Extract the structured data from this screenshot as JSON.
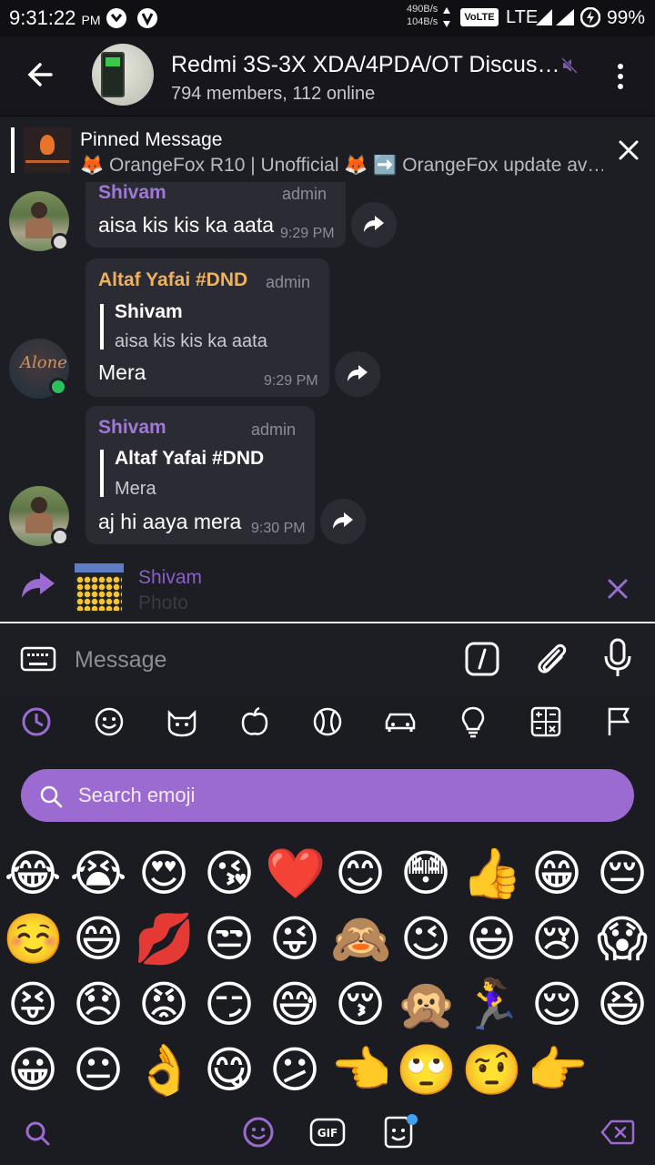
{
  "status_bar": {
    "time": "9:31:22",
    "ampm": "PM",
    "net_up": "490B/s",
    "net_down": "104B/s",
    "volte": "VoLTE",
    "lte": "LTE",
    "battery": "99%"
  },
  "header": {
    "title": "Redmi 3S-3X XDA/4PDA/OT Discus…",
    "subtitle": "794 members, 112 online"
  },
  "pinned": {
    "label": "Pinned Message",
    "text": "🦊 OrangeFox R10 | Unofficial 🦊 ➡️ OrangeFox update av…"
  },
  "messages": [
    {
      "sender": "Shivam",
      "tag": "admin",
      "text": "aisa kis kis ka aata",
      "time": "9:29 PM"
    },
    {
      "sender": "Altaf Yafai #DND",
      "tag": "admin",
      "reply_name": "Shivam",
      "reply_text": "aisa kis kis ka aata",
      "text": "Mera",
      "time": "9:29 PM",
      "avatar_text": "Alone"
    },
    {
      "sender": "Shivam",
      "tag": "admin",
      "reply_name": "Altaf Yafai #DND",
      "reply_text": "Mera",
      "text": "aj hi aaya mera",
      "time": "9:30 PM"
    }
  ],
  "reply_preview": {
    "name": "Shivam",
    "sub": "Photo"
  },
  "input": {
    "placeholder": "Message"
  },
  "emoji_search": {
    "placeholder": "Search emoji"
  },
  "emoji_categories": [
    "recent-icon",
    "smiley-icon",
    "animal-icon",
    "food-icon",
    "sports-icon",
    "travel-icon",
    "objects-icon",
    "symbols-icon",
    "flags-icon"
  ],
  "emojis": [
    [
      "😂",
      "😭",
      "😍",
      "😘",
      "❤️",
      "😊",
      "😳",
      "👍",
      "😁",
      "😔"
    ],
    [
      "☺️",
      "😄",
      "💋",
      "😒",
      "😜",
      "🙈",
      "😉",
      "😃",
      "😢",
      "😱"
    ],
    [
      "😝",
      "😞",
      "😡",
      "😏",
      "😅",
      "😚",
      "🙊",
      "🏃‍♀️",
      "😌",
      "😆"
    ],
    [
      "😀",
      "😐",
      "👌",
      "😋",
      "😕",
      "👈",
      "🙄",
      "🤨",
      "👉"
    ]
  ],
  "colors": {
    "accent": "#9c6bd2",
    "shivam": "#a078d8",
    "altaf": "#f0b15a",
    "online": "#29c15b",
    "offline": "#d8d8d8"
  }
}
